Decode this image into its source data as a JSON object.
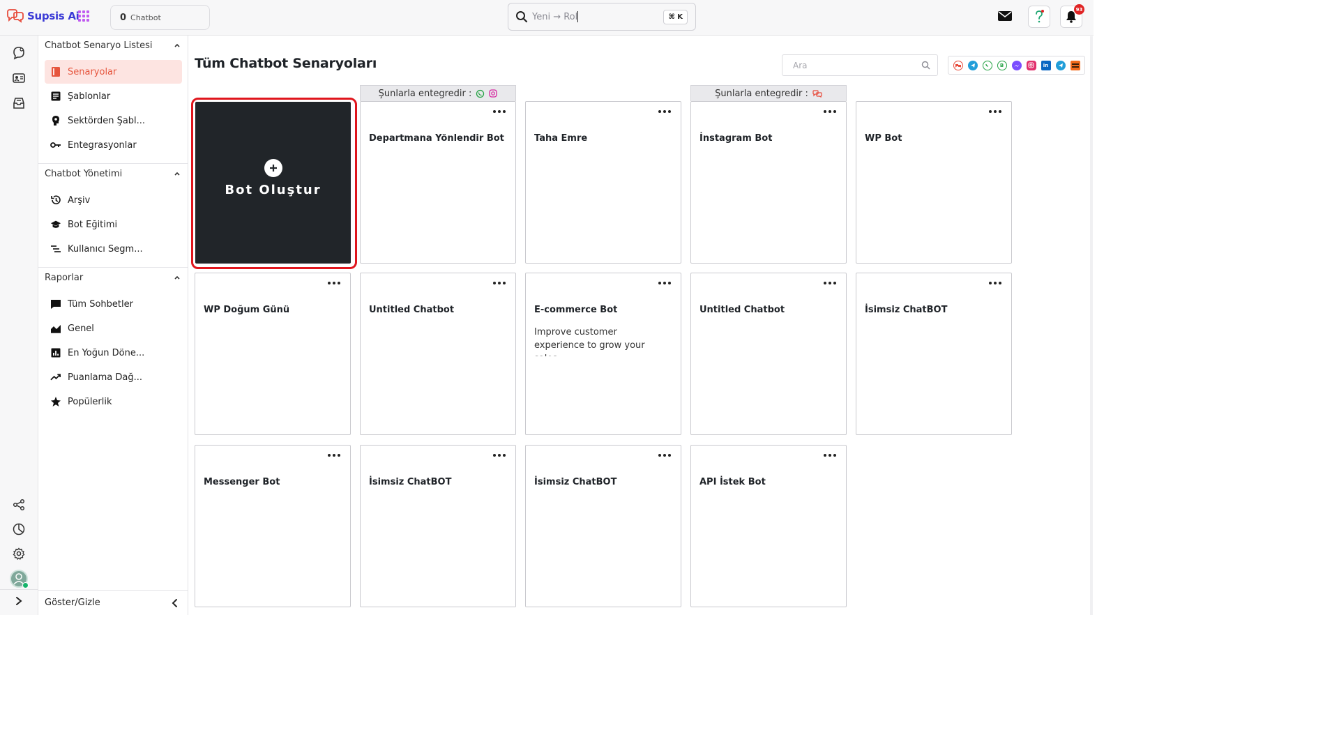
{
  "app": {
    "name": "Supsis Ai"
  },
  "topbar": {
    "chatbot_count": "0",
    "chatbot_label": "Chatbot",
    "search_value": "Yeni → Rol",
    "shortcut": "⌘ K",
    "notification_count": "93"
  },
  "sidebar": {
    "sections": [
      {
        "title": "Chatbot Senaryo Listesi",
        "items": [
          {
            "label": "Senaryolar",
            "icon": "book-icon",
            "active": true
          },
          {
            "label": "Şablonlar",
            "icon": "template-icon"
          },
          {
            "label": "Sektörden Şabl...",
            "icon": "head-icon"
          },
          {
            "label": "Entegrasyonlar",
            "icon": "key-icon"
          }
        ]
      },
      {
        "title": "Chatbot Yönetimi",
        "items": [
          {
            "label": "Arşiv",
            "icon": "history-icon"
          },
          {
            "label": "Bot Eğitimi",
            "icon": "graduation-cap-icon"
          },
          {
            "label": "Kullanıcı Segm...",
            "icon": "segment-icon"
          }
        ]
      },
      {
        "title": "Raporlar",
        "items": [
          {
            "label": "Tüm Sohbetler",
            "icon": "chat-icon"
          },
          {
            "label": "Genel",
            "icon": "area-chart-icon"
          },
          {
            "label": "En Yoğun Döne...",
            "icon": "bar-chart-icon"
          },
          {
            "label": "Puanlama Dağ...",
            "icon": "trend-icon"
          },
          {
            "label": "Popülerlik",
            "icon": "star-icon"
          }
        ]
      }
    ],
    "toggle_label": "Göster/Gizle"
  },
  "main": {
    "title": "Tüm Chatbot Senaryoları",
    "search_placeholder": "Ara",
    "channels": [
      "supsis-icon",
      "telegram-icon",
      "whatsapp-icon",
      "whatsapp-business-icon",
      "messenger-icon",
      "instagram-icon",
      "linkedin-icon",
      "telegram-icon",
      "api-icon"
    ],
    "integration_label": "Şunlarla entegredir :",
    "create_label": "Bot Oluştur",
    "cards": [
      {
        "name": "Departmana Yönlendir Bot",
        "integrations": [
          "whatsapp-icon",
          "instagram-icon"
        ]
      },
      {
        "name": "Taha Emre"
      },
      {
        "name": "İnstagram Bot",
        "integrations": [
          "supsis-icon"
        ]
      },
      {
        "name": "WP Bot"
      },
      {
        "name": "WP Doğum Günü"
      },
      {
        "name": "Untitled Chatbot"
      },
      {
        "name": "E-commerce Bot",
        "description": "Improve customer experience to grow your sales."
      },
      {
        "name": "Untitled Chatbot"
      },
      {
        "name": "İsimsiz ChatBOT"
      },
      {
        "name": "Messenger Bot"
      },
      {
        "name": "İsimsiz ChatBOT"
      },
      {
        "name": "İsimsiz ChatBOT"
      },
      {
        "name": "API İstek Bot"
      }
    ]
  },
  "colors": {
    "accent": "#e6553d",
    "brand": "#3b3bd6",
    "create_bg": "#212529",
    "highlight": "#e0161d"
  }
}
